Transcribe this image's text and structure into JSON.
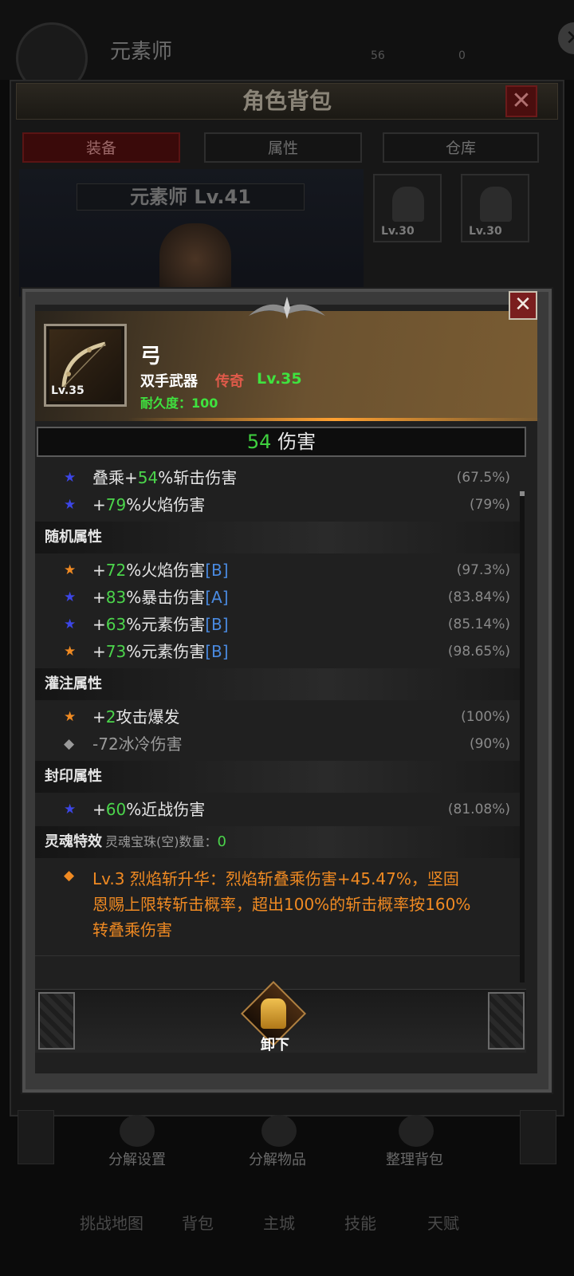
{
  "background": {
    "character_name": "元素师",
    "stat_a": "56",
    "stat_b": "0",
    "bag_title": "角色背包",
    "tabs": [
      "装备",
      "属性",
      "仓库"
    ],
    "character_level": "元素师 Lv.41",
    "slots": [
      {
        "level": "Lv.30"
      },
      {
        "level": "Lv.30"
      }
    ],
    "actions": [
      "分解设置",
      "分解物品",
      "整理背包"
    ],
    "nav": [
      "挑战地图",
      "背包",
      "主城",
      "技能",
      "天赋"
    ]
  },
  "item": {
    "name": "弓",
    "slot_level": "Lv.35",
    "type": "双手武器",
    "rarity": "传奇",
    "level": "Lv.35",
    "durability_label": "耐久度：",
    "durability_value": "100",
    "damage_value": "54",
    "damage_label": "伤害"
  },
  "base_stats": [
    {
      "star": "blue",
      "prefix": "叠乘+",
      "value": "54",
      "suffix": "%斩击伤害",
      "pct": "(67.5%)"
    },
    {
      "star": "blue",
      "prefix": "+",
      "value": "79",
      "suffix": "%火焰伤害",
      "pct": "(79%)"
    }
  ],
  "random_section": {
    "title": "随机属性",
    "stats": [
      {
        "star": "orange",
        "value": "72",
        "suffix": "%火焰伤害",
        "tag": "[B]",
        "pct": "(97.3%)"
      },
      {
        "star": "blue",
        "value": "83",
        "suffix": "%暴击伤害",
        "tag": "[A]",
        "pct": "(83.84%)"
      },
      {
        "star": "blue",
        "value": "63",
        "suffix": "%元素伤害",
        "tag": "[B]",
        "pct": "(85.14%)"
      },
      {
        "star": "orange",
        "value": "73",
        "suffix": "%元素伤害",
        "tag": "[B]",
        "pct": "(98.65%)"
      }
    ]
  },
  "infuse_section": {
    "title": "灌注属性",
    "stats": [
      {
        "star": "orange",
        "prefix": "+",
        "value": "2",
        "suffix": "攻击爆发",
        "pct": "(100%)"
      },
      {
        "star": "grey",
        "text": "-72冰冷伤害",
        "pct": "(90%)"
      }
    ]
  },
  "seal_section": {
    "title": "封印属性",
    "stats": [
      {
        "star": "blue",
        "prefix": "+",
        "value": "60",
        "suffix": "%近战伤害",
        "pct": "(81.08%)"
      }
    ]
  },
  "soul_section": {
    "title": "灵魂特效",
    "gem_label": "灵魂宝珠(空)数量：",
    "gem_count": "0",
    "effect_line1": "Lv.3 烈焰斩升华：烈焰斩叠乘伤害+45.47%，坚固",
    "effect_line2": "恩赐上限转斩击概率，超出100%的斩击概率按160%",
    "effect_line3": "转叠乘伤害"
  },
  "footer": {
    "unequip_label": "卸下"
  },
  "icons": {
    "star": "★",
    "diamond": "◆",
    "close": "✕"
  },
  "colors": {
    "green": "#4bd44b",
    "legendary": "#e05a4a",
    "blue_star": "#3c46e6",
    "orange_star": "#f08a22"
  }
}
